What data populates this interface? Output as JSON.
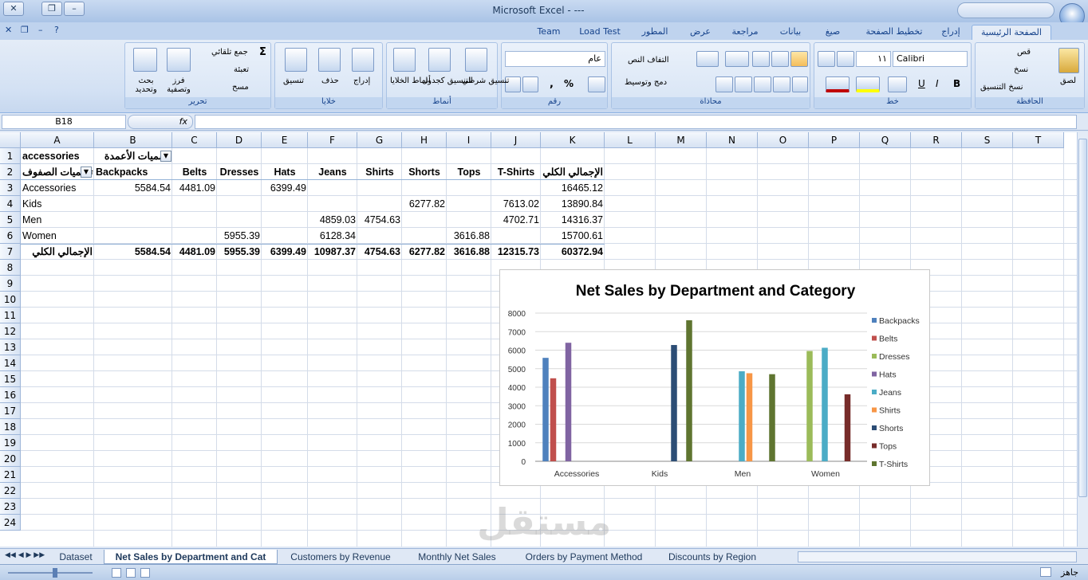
{
  "window": {
    "title": "Microsoft Excel - ---"
  },
  "tabs": [
    "الصفحة الرئيسية",
    "إدراج",
    "تخطيط الصفحة",
    "صيغ",
    "بيانات",
    "مراجعة",
    "عرض",
    "المطور",
    "Load Test",
    "Team"
  ],
  "ribbon": {
    "clipboard": {
      "label": "الحافظة",
      "paste": "لصق",
      "cut": "قص",
      "copy": "نسخ",
      "format_painter": "نسخ التنسيق"
    },
    "font": {
      "label": "خط",
      "name": "Calibri",
      "size": "١١",
      "bold": "B",
      "italic": "I",
      "underline": "U"
    },
    "alignment": {
      "label": "محاذاة",
      "wrap": "التفاف النص",
      "merge": "دمج وتوسيط"
    },
    "number": {
      "label": "رقم",
      "format": "عام",
      "percent": "%",
      "comma": ","
    },
    "styles": {
      "label": "أنماط",
      "conditional": "تنسيق شرطي",
      "as_table": "التنسيق كجدول",
      "cell_styles": "أنماط الخلايا"
    },
    "cells": {
      "label": "خلايا",
      "insert": "إدراج",
      "delete": "حذف",
      "format": "تنسيق"
    },
    "editing": {
      "label": "تحرير",
      "autosum": "جمع تلقائي",
      "fill": "تعبئة",
      "clear": "مسح",
      "sort": "فرز وتصفية",
      "find": "بحث وتحديد"
    }
  },
  "formula": {
    "namebox": "B18",
    "fx": "fx"
  },
  "columns": [
    "A",
    "B",
    "C",
    "D",
    "E",
    "F",
    "G",
    "H",
    "I",
    "J",
    "K",
    "L",
    "M",
    "N",
    "O",
    "P",
    "Q",
    "R",
    "S",
    "T"
  ],
  "rows": [
    "1",
    "2",
    "3",
    "4",
    "5",
    "6",
    "7",
    "8",
    "9",
    "10",
    "11",
    "12",
    "13",
    "14",
    "15",
    "16",
    "17",
    "18",
    "19",
    "20",
    "21",
    "22",
    "23",
    "24"
  ],
  "pivot": {
    "filter_label": "accessories",
    "col_label": "تسميات الأعمدة",
    "row_label": "تسميات الصفوف",
    "headers": [
      "Backpacks",
      "Belts",
      "Dresses",
      "Hats",
      "Jeans",
      "Shirts",
      "Shorts",
      "Tops",
      "T-Shirts",
      "الإجمالي الكلي"
    ],
    "rows": [
      {
        "name": "Accessories",
        "vals": [
          "5584.54",
          "4481.09",
          "",
          "6399.49",
          "",
          "",
          "",
          "",
          "",
          "16465.12"
        ]
      },
      {
        "name": "Kids",
        "vals": [
          "",
          "",
          "",
          "",
          "",
          "",
          "6277.82",
          "",
          "7613.02",
          "13890.84"
        ]
      },
      {
        "name": "Men",
        "vals": [
          "",
          "",
          "",
          "",
          "4859.03",
          "4754.63",
          "",
          "",
          "4702.71",
          "14316.37"
        ]
      },
      {
        "name": "Women",
        "vals": [
          "",
          "",
          "5955.39",
          "",
          "6128.34",
          "",
          "",
          "3616.88",
          "",
          "15700.61"
        ]
      }
    ],
    "total": {
      "name": "الإجمالي الكلي",
      "vals": [
        "5584.54",
        "4481.09",
        "5955.39",
        "6399.49",
        "10987.37",
        "4754.63",
        "6277.82",
        "3616.88",
        "12315.73",
        "60372.94"
      ]
    }
  },
  "chart_data": {
    "type": "bar",
    "title": "Net Sales by Department and Category",
    "categories": [
      "Accessories",
      "Kids",
      "Men",
      "Women"
    ],
    "ylim": [
      0,
      8000
    ],
    "yticks": [
      "0",
      "1000",
      "2000",
      "3000",
      "4000",
      "5000",
      "6000",
      "7000",
      "8000"
    ],
    "legend_position": "right",
    "series": [
      {
        "name": "Backpacks",
        "color": "#4f81bd",
        "values": [
          5584.54,
          0,
          0,
          0
        ]
      },
      {
        "name": "Belts",
        "color": "#c0504d",
        "values": [
          4481.09,
          0,
          0,
          0
        ]
      },
      {
        "name": "Dresses",
        "color": "#9bbb59",
        "values": [
          0,
          0,
          0,
          5955.39
        ]
      },
      {
        "name": "Hats",
        "color": "#8064a2",
        "values": [
          6399.49,
          0,
          0,
          0
        ]
      },
      {
        "name": "Jeans",
        "color": "#4bacc6",
        "values": [
          0,
          0,
          4859.03,
          6128.34
        ]
      },
      {
        "name": "Shirts",
        "color": "#f79646",
        "values": [
          0,
          0,
          4754.63,
          0
        ]
      },
      {
        "name": "Shorts",
        "color": "#2c4d75",
        "values": [
          0,
          6277.82,
          0,
          0
        ]
      },
      {
        "name": "Tops",
        "color": "#772c2a",
        "values": [
          0,
          0,
          0,
          3616.88
        ]
      },
      {
        "name": "T-Shirts",
        "color": "#5f7530",
        "values": [
          0,
          7613.02,
          4702.71,
          0
        ]
      }
    ]
  },
  "sheets": [
    "Dataset",
    "Net Sales by Department and Cat",
    "Customers by Revenue",
    "Monthly Net Sales",
    "Orders by Payment Method",
    "Discounts by Region"
  ],
  "status": {
    "ready": "جاهز"
  },
  "watermark": "مستقل"
}
